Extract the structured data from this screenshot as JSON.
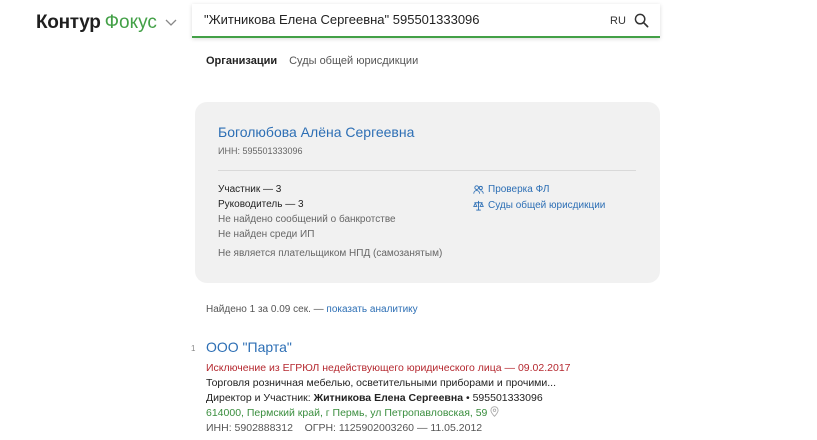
{
  "header": {
    "logo_part1": "Контур",
    "logo_part2": "Фокус",
    "search_value": "\"Житникова Елена Сергеевна\" 595501333096",
    "lang": "RU"
  },
  "tabs": [
    {
      "label": "Организации",
      "active": true
    },
    {
      "label": "Суды общей юрисдикции",
      "active": false
    }
  ],
  "person_card": {
    "name": "Боголюбова Алёна Сергеевна",
    "inn": "ИНН: 595501333096",
    "lines": [
      "Участник — 3",
      "Руководитель — 3",
      "Не найдено сообщений о банкротстве",
      "Не найден среди ИП"
    ],
    "npd": "Не является плательщиком НПД (самозанятым)",
    "links": [
      {
        "label": "Проверка ФЛ",
        "icon": "people-icon"
      },
      {
        "label": "Суды общей юрисдикции",
        "icon": "scales-icon"
      }
    ]
  },
  "found": {
    "text": "Найдено 1 за 0.09 сек. — ",
    "link": "показать аналитику"
  },
  "result": {
    "number": "1",
    "title": "ООО \"Парта\"",
    "exclusion": "Исключение из ЕГРЮЛ недействующего юридического лица — 09.02.2017",
    "activity": "Торговля розничная мебелью, осветительными приборами и прочими...",
    "director_prefix": "Директор и Участник: ",
    "director_name": "Житникова Елена Сергеевна",
    "director_inn": " • 595501333096",
    "address": "614000, Пермский край, г Пермь, ул Петропавловская, 59",
    "ids": "ИНН: 5902888312    ОГРН: 1125902003260 — 11.05.2012"
  },
  "colors": {
    "accent_green": "#43a047",
    "link_blue": "#2d6fb5",
    "warning_red": "#b5282f",
    "card_bg": "#f1f1f1"
  }
}
